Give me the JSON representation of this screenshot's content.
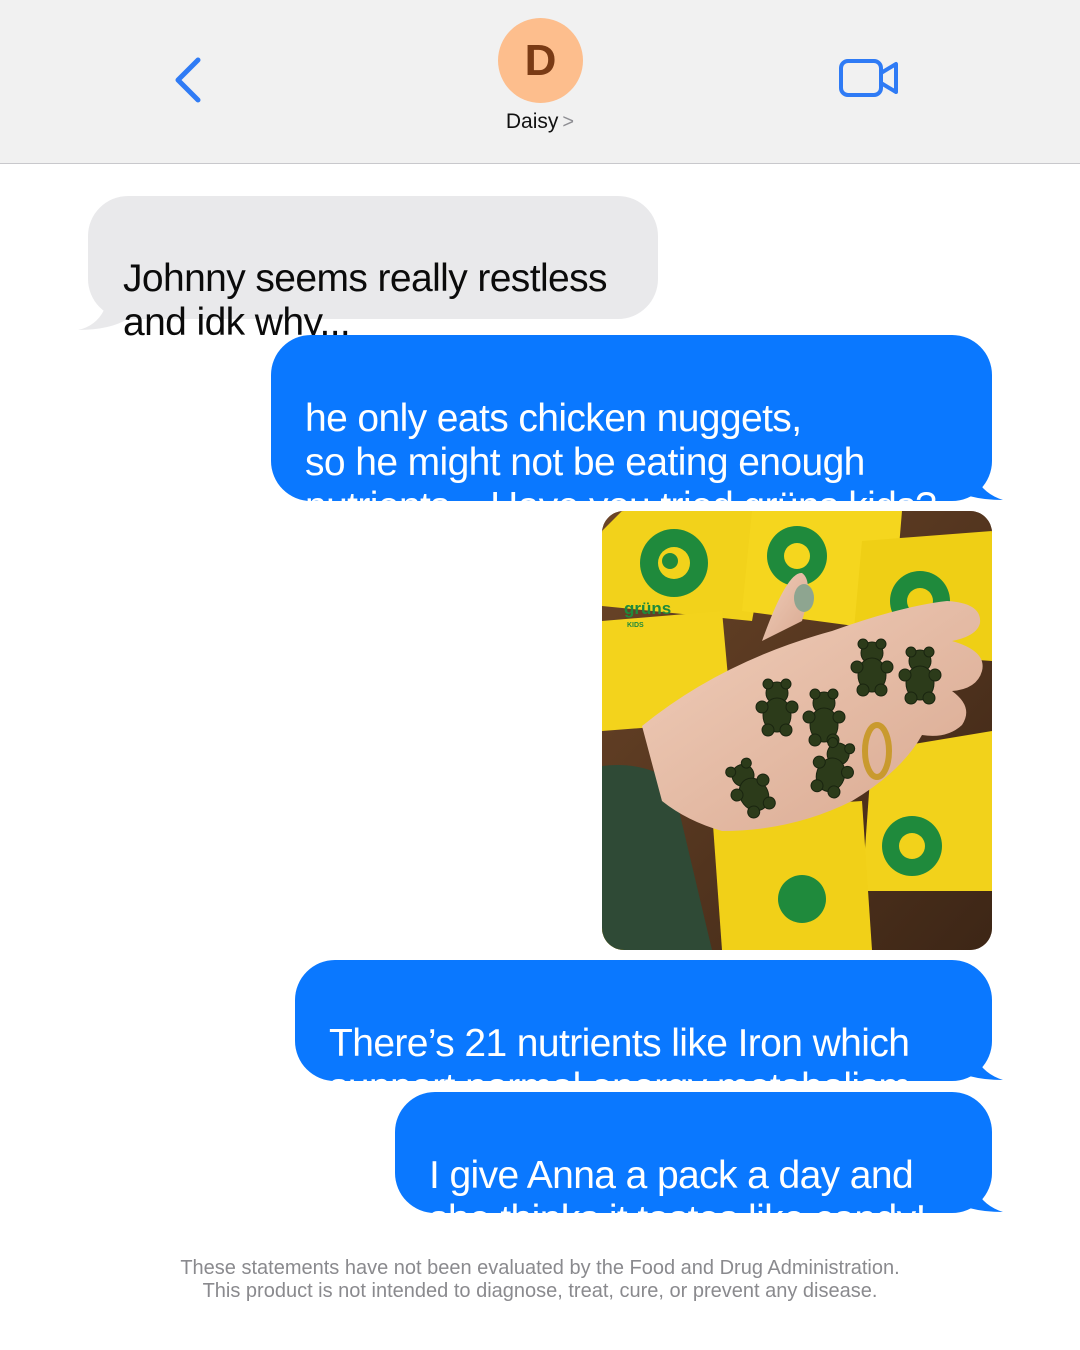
{
  "header": {
    "avatar_initial": "D",
    "contact_name": "Daisy",
    "contact_chevron": ">",
    "back_icon": "chevron-left-icon",
    "video_icon": "video-camera-icon",
    "accent_color": "#0a78ff",
    "avatar_color": "#fdbe8d"
  },
  "messages": [
    {
      "direction": "incoming",
      "text": "Johnny seems really restless\nand idk why..."
    },
    {
      "direction": "outgoing",
      "text": "he only eats chicken nuggets,\nso he might not be eating enough\nnutrients... Have you tried grüns kids?"
    },
    {
      "direction": "outgoing",
      "type": "photo",
      "alt": "hand holding green gummy bears over yellow packets"
    },
    {
      "direction": "outgoing",
      "text": "There’s 21 nutrients like Iron which\nsupport normal energy metabolism."
    },
    {
      "direction": "outgoing",
      "text": "I give Anna a pack a day and\nshe thinks it tastes like candy!"
    }
  ],
  "photo": {
    "packet_brand": "grüns",
    "packet_subtitle": "KIDS"
  },
  "disclaimer": "These statements have not been evaluated by the Food and Drug Administration.\nThis product is not intended to diagnose, treat, cure, or prevent any disease."
}
